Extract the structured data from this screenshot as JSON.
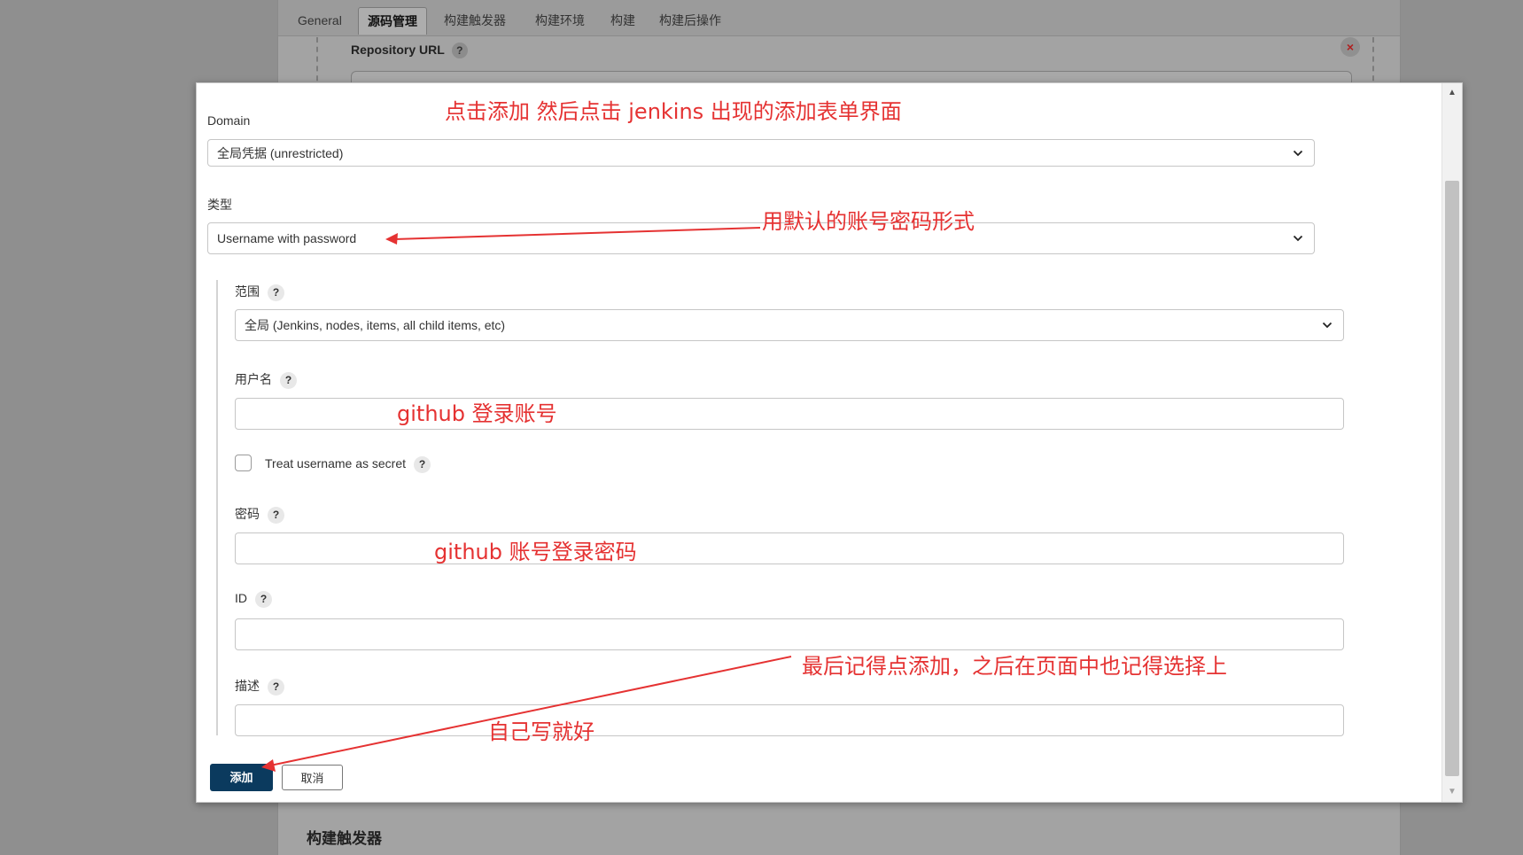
{
  "tabs": [
    {
      "label": "General",
      "active": false
    },
    {
      "label": "源码管理",
      "active": true
    },
    {
      "label": "构建触发器",
      "active": false
    },
    {
      "label": "构建环境",
      "active": false
    },
    {
      "label": "构建",
      "active": false
    },
    {
      "label": "构建后操作",
      "active": false
    }
  ],
  "background": {
    "repository_url_label": "Repository URL",
    "help_glyph": "?",
    "close_glyph": "×",
    "section_title": "构建触发器"
  },
  "modal": {
    "domain": {
      "label": "Domain",
      "value": "全局凭据 (unrestricted)"
    },
    "kind": {
      "label": "类型",
      "value": "Username with password"
    },
    "scope": {
      "label": "范围",
      "value": "全局 (Jenkins, nodes, items, all child items, etc)"
    },
    "username": {
      "label": "用户名",
      "value": ""
    },
    "treat_secret": {
      "label": "Treat username as secret",
      "checked": false
    },
    "password": {
      "label": "密码",
      "value": ""
    },
    "id": {
      "label": "ID",
      "value": ""
    },
    "description": {
      "label": "描述",
      "value": ""
    },
    "help_glyph": "?",
    "add_button": "添加",
    "cancel_button": "取消",
    "scroll_up_glyph": "▲",
    "scroll_down_glyph": "▼"
  },
  "annotations": {
    "top": "点击添加 然后点击 jenkins 出现的添加表单界面",
    "kind": "用默认的账号密码形式",
    "username": "github 登录账号",
    "password": "github 账号登录密码",
    "add": "最后记得点添加，之后在页面中也记得选择上",
    "description": "自己写就好",
    "color": "#e53232"
  }
}
